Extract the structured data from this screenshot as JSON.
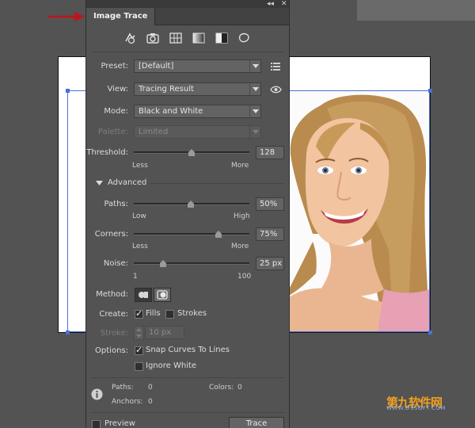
{
  "panel": {
    "tab_label": "Image Trace",
    "collapse_glyph": "◂◂",
    "close_glyph": "✕",
    "preset_icons": [
      "auto-color-icon",
      "high-color-icon",
      "low-color-icon",
      "grayscale-icon",
      "black-and-white-icon",
      "outline-icon"
    ],
    "preset": {
      "label": "Preset:",
      "value": "[Default]"
    },
    "view": {
      "label": "View:",
      "value": "Tracing Result"
    },
    "mode": {
      "label": "Mode:",
      "value": "Black and White"
    },
    "palette": {
      "label": "Palette:",
      "value": "Limited"
    },
    "threshold": {
      "label": "Threshold:",
      "value": "128",
      "min_label": "Less",
      "max_label": "More",
      "level": 0.5
    },
    "advanced": {
      "label": "Advanced"
    },
    "paths": {
      "label": "Paths:",
      "value": "50%",
      "min_label": "Low",
      "max_label": "High",
      "level": 0.5
    },
    "corners": {
      "label": "Corners:",
      "value": "75%",
      "min_label": "Less",
      "max_label": "More",
      "level": 0.75
    },
    "noise": {
      "label": "Noise:",
      "value": "25 px",
      "min_label": "1",
      "max_label": "100",
      "level": 0.24
    },
    "method": {
      "label": "Method:",
      "options": [
        "abutting",
        "overlapping"
      ],
      "selected": "abutting"
    },
    "create": {
      "label": "Create:",
      "fills_label": "Fills",
      "fills_checked": true,
      "strokes_label": "Strokes",
      "strokes_checked": false
    },
    "stroke": {
      "label": "Stroke:",
      "value": "10 px"
    },
    "options": {
      "label": "Options:",
      "snap_label": "Snap Curves To Lines",
      "snap_checked": true,
      "ignore_white_label": "Ignore White",
      "ignore_white_checked": false
    },
    "info": {
      "paths_label": "Paths:",
      "paths_value": "0",
      "colors_label": "Colors:",
      "colors_value": "0",
      "anchors_label": "Anchors:",
      "anchors_value": "0"
    },
    "preview_label": "Preview",
    "preview_checked": false,
    "trace_label": "Trace"
  },
  "watermark": {
    "line1": "第九软件网",
    "line2": "WWW.D9SOFT.COM"
  },
  "colors": {
    "panel_bg": "#535353",
    "selection": "#4a6fd6",
    "arrow": "#c0141c",
    "watermark": "#f0a020"
  }
}
